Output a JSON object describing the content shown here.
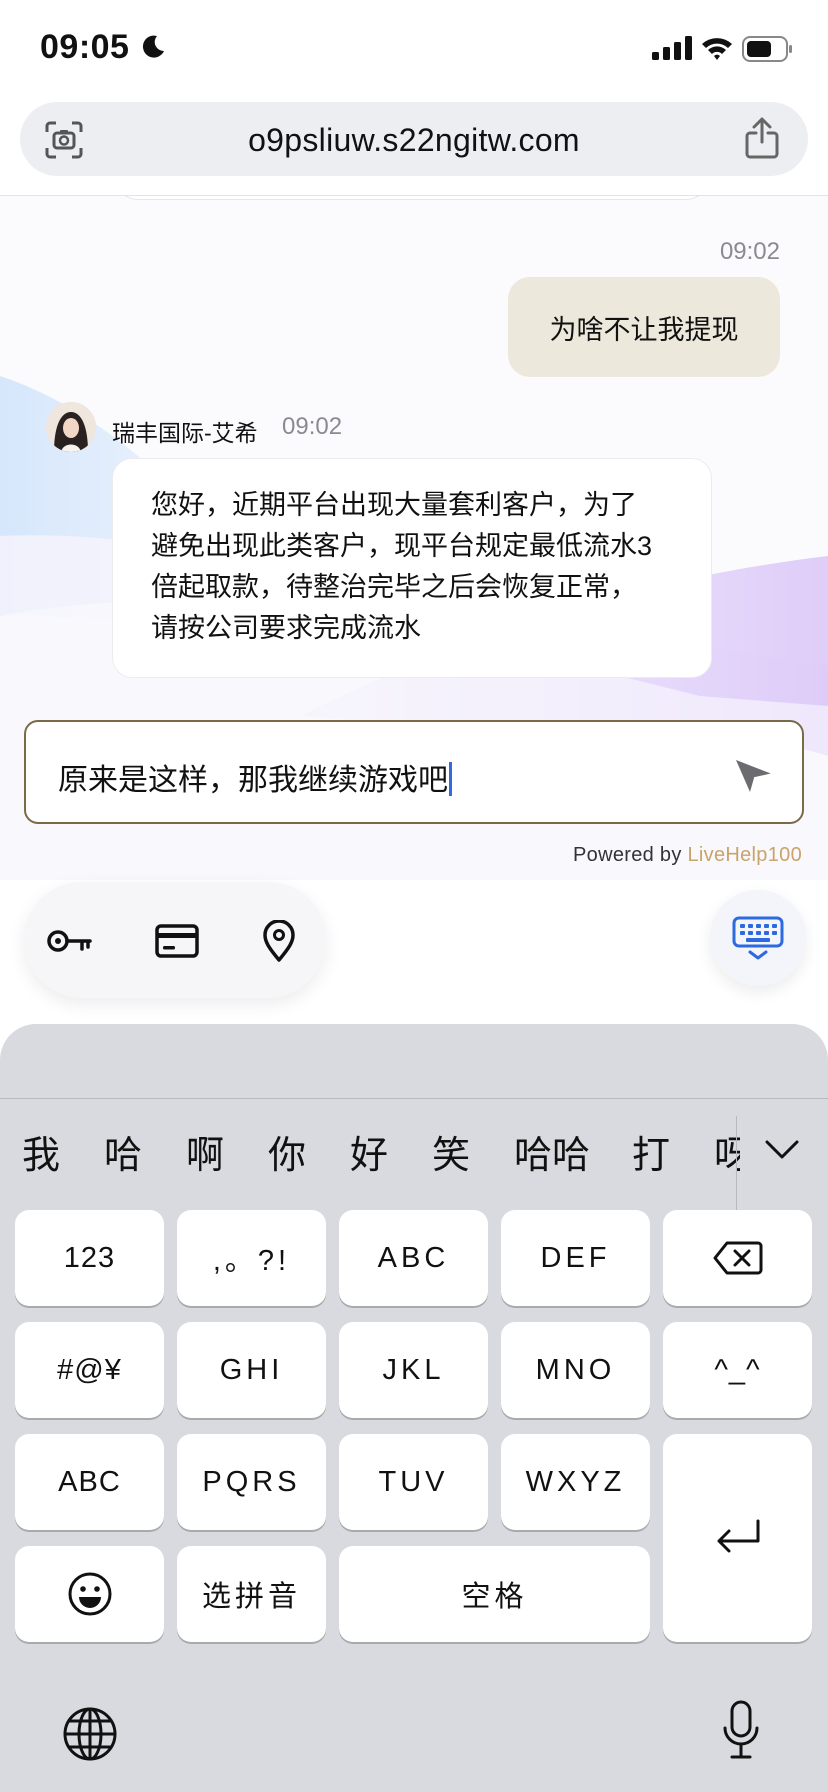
{
  "status_bar": {
    "time": "09:05",
    "icons": [
      "moon-icon",
      "cellular-signal-icon",
      "wifi-icon",
      "battery-icon"
    ]
  },
  "browser": {
    "url": "o9psliuw.s22ngitw.com",
    "icons": [
      "camera-scan-icon",
      "share-icon"
    ]
  },
  "chat": {
    "messages": [
      {
        "sender": "me",
        "time": "09:02",
        "text": "为啥不让我提现"
      },
      {
        "sender": "agent",
        "agent_name": "瑞丰国际-艾希",
        "time": "09:02",
        "lines": [
          "您好，近期平台出现大量套利客户，为了",
          "避免出现此类客户，现平台规定最低流水3",
          "倍起取款，待整治完毕之后会恢复正常，",
          "请按公司要求完成流水"
        ]
      }
    ],
    "input_value": "原来是这样，那我继续游戏吧",
    "powered_by_prefix": "Powered by",
    "powered_by_brand": "LiveHelp100"
  },
  "toolbar": {
    "icons": [
      "key-icon",
      "card-icon",
      "location-pin-icon"
    ],
    "keyboard_toggle": "keyboard-icon"
  },
  "keyboard": {
    "candidates": [
      "我",
      "哈",
      "啊",
      "你",
      "好",
      "笑",
      "哈哈",
      "打",
      "呀"
    ],
    "row1": [
      "123",
      ",。?!",
      "ABC",
      "DEF"
    ],
    "row2": [
      "#@¥",
      "GHI",
      "JKL",
      "MNO",
      "^_^"
    ],
    "row3": [
      "ABC",
      "PQRS",
      "TUV",
      "WXYZ"
    ],
    "row4": {
      "pinyin": "选拼音",
      "space": "空格"
    }
  },
  "colors": {
    "accent": "#3469e0",
    "my_bubble": "#ede8dc",
    "brand": "#c9a36a",
    "input_border": "#7a6a48"
  }
}
